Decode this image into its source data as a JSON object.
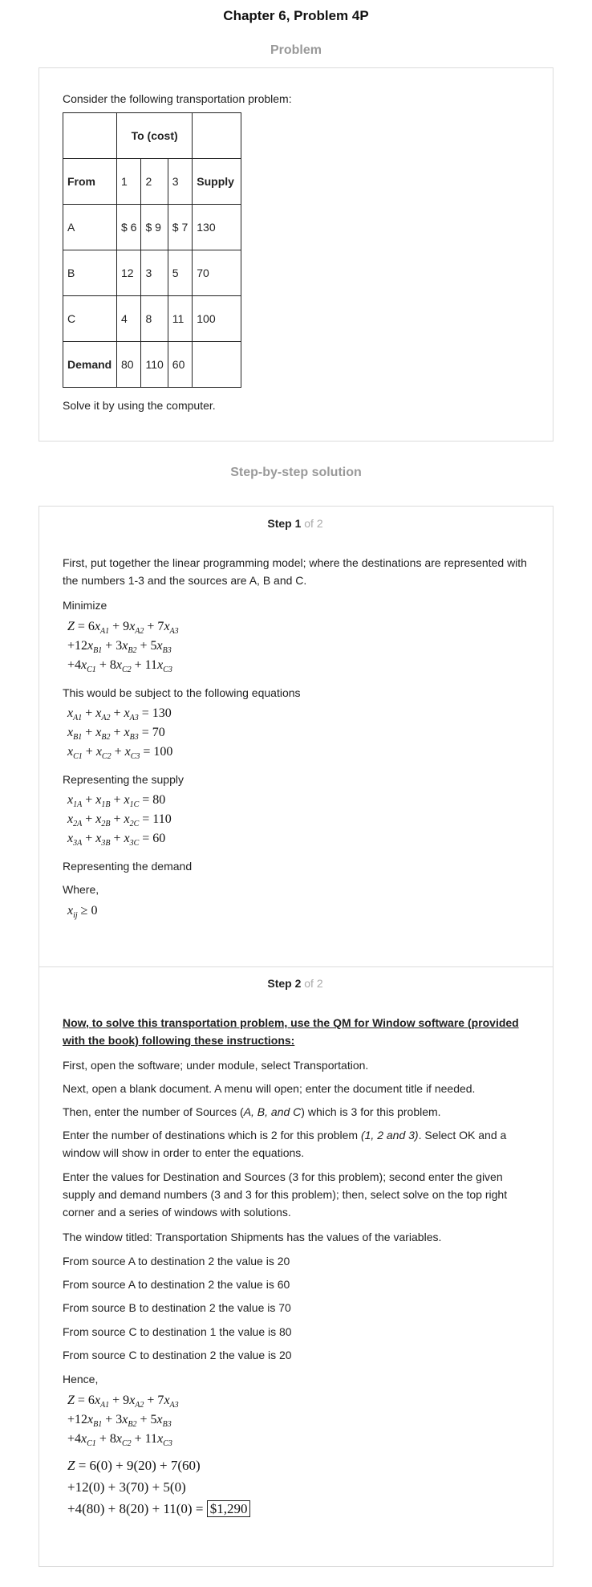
{
  "title": "Chapter 6, Problem 4P",
  "problem_heading": "Problem",
  "problem": {
    "intro": "Consider the following transportation problem:",
    "table": {
      "to_header": "To (cost)",
      "header": [
        "From",
        "1",
        "2",
        "3",
        "Supply"
      ],
      "rows": [
        [
          "A",
          "$ 6",
          "$ 9",
          "$ 7",
          "130"
        ],
        [
          "B",
          "12",
          "3",
          "5",
          "70"
        ],
        [
          "C",
          "4",
          "8",
          "11",
          "100"
        ],
        [
          "Demand",
          "80",
          "110",
          "60",
          ""
        ]
      ]
    },
    "outro": "Solve it by using the computer."
  },
  "solution_heading": "Step-by-step solution",
  "step1": {
    "label": "Step 1",
    "of": "of 2",
    "p1": "First, put together the linear programming model; where the destinations are represented with the numbers 1-3 and the sources are A, B and C.",
    "minimize": "Minimize",
    "subject": "This would be subject to the following equations",
    "rep_supply": "Representing the supply",
    "rep_demand": "Representing the demand",
    "where": "Where,"
  },
  "step2": {
    "label": "Step 2",
    "of": "of 2",
    "heading": "Now, to solve this transportation problem, use the QM for Window software (provided with the book) following these instructions:",
    "p1": "First, open the software; under module, select Transportation.",
    "p2": "Next, open a blank document. A menu will open; enter the document title if needed.",
    "p3_a": "Then, enter the number of Sources (",
    "p3_i": "A, B, and C",
    "p3_b": ") which is 3 for this problem.",
    "p4_a": "Enter the number of destinations which is 2 for this problem ",
    "p4_i": "(1, 2 and 3)",
    "p4_b": ". Select OK and a window will show in order to enter the equations.",
    "p5": "Enter the values for Destination and Sources (3 for this problem); second enter the given supply and demand numbers (3 and 3 for this problem); then, select solve on the top right corner and a series of windows with solutions.",
    "p6": "The window titled: Transportation Shipments has the values of the variables.",
    "r1": "From source A to destination 2 the value is 20",
    "r2": "From source A to destination 2 the value is 60",
    "r3": "From source B to destination 2 the value is 70",
    "r4": "From source C to destination 1 the value is 80",
    "r5": "From source C to destination 2 the value is 20",
    "hence": "Hence,",
    "answer": "$1,290"
  }
}
